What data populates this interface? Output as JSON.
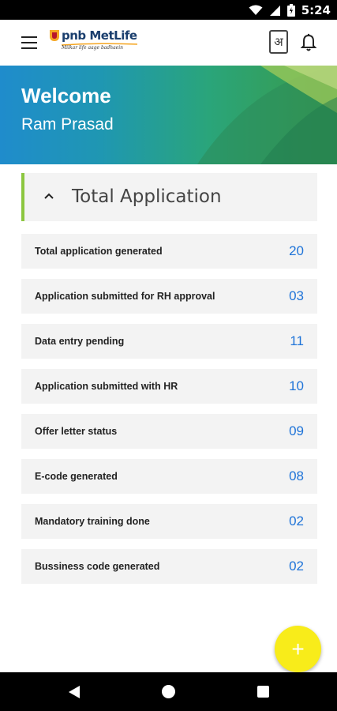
{
  "status_bar": {
    "time": "5:24",
    "icons": [
      "wifi-icon",
      "signal-icon",
      "battery-icon"
    ]
  },
  "app_bar": {
    "logo_text": "pnb MetLife",
    "logo_tagline": "Milkar life aage badhaein",
    "language_label": "अ",
    "icons": [
      "menu-icon",
      "language-icon",
      "bell-icon"
    ]
  },
  "banner": {
    "welcome": "Welcome",
    "user_name": "Ram Prasad"
  },
  "section": {
    "title": "Total Application",
    "expanded": true
  },
  "rows": [
    {
      "label": "Total application generated",
      "value": "20"
    },
    {
      "label": "Application submitted for RH approval",
      "value": "03"
    },
    {
      "label": "Data entry pending",
      "value": "11"
    },
    {
      "label": "Application submitted with HR",
      "value": "10"
    },
    {
      "label": "Offer letter status",
      "value": "09"
    },
    {
      "label": "E-code generated",
      "value": "08"
    },
    {
      "label": "Mandatory training done",
      "value": "02"
    },
    {
      "label": "Bussiness code generated",
      "value": "02"
    }
  ],
  "fab": {
    "label": "+"
  },
  "colors": {
    "accent_green": "#8cc63f",
    "value_blue": "#1e73d8",
    "fab_yellow": "#f8ec1a",
    "banner_blue": "#1f8ccc",
    "banner_green": "#3a9a47"
  }
}
